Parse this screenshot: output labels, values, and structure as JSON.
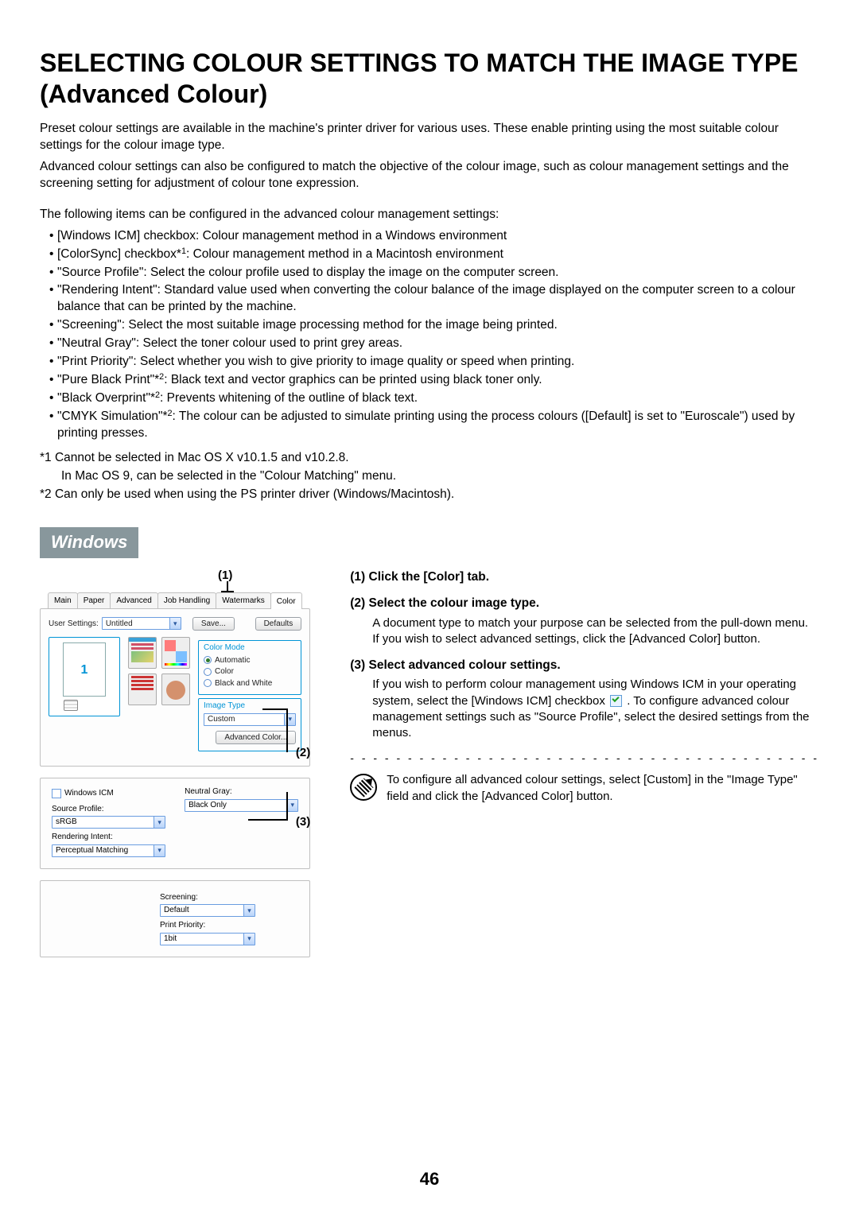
{
  "title": "SELECTING COLOUR SETTINGS TO MATCH THE IMAGE TYPE (Advanced Colour)",
  "intro1": "Preset colour settings are available in the machine's printer driver for various uses. These enable printing using the most suitable colour settings for the colour image type.",
  "intro1b": "Advanced colour settings can also be configured to match the objective of the colour image, such as colour management settings and the screening setting for adjustment of colour tone expression.",
  "intro2": "The following items can be configured in the advanced colour management settings:",
  "bullets": {
    "b0": "[Windows ICM] checkbox: Colour management method in a Windows environment",
    "b1a": "[ColorSync] checkbox*",
    "b1b": ":  Colour management method in a Macintosh environment",
    "b2": "\"Source Profile\":  Select the colour profile used to display the image on the computer screen.",
    "b3": "\"Rendering Intent\": Standard value used when converting the colour balance of the image displayed on the computer screen to a colour balance that can be printed by the machine.",
    "b4": "\"Screening\":  Select the most suitable image processing method for the image being printed.",
    "b5": "\"Neutral Gray\":  Select the toner colour used to print grey areas.",
    "b6": "\"Print Priority\":   Select whether you wish to give priority to image quality or speed when printing.",
    "b7a": "\"Pure Black Print\"*",
    "b7b": ":  Black text and vector graphics can be printed using black toner only.",
    "b8a": "\"Black Overprint\"*",
    "b8b": ":  Prevents whitening of the outline of black text.",
    "b9a": "\"CMYK Simulation\"*",
    "b9b": ":  The colour can be adjusted to simulate printing using the process colours ([Default] is set to \"Euroscale\") used by printing presses."
  },
  "sup": {
    "s1": "1",
    "s2": "2"
  },
  "footnotes": {
    "f1": "*1  Cannot be selected in Mac OS X v10.1.5 and v10.2.8.",
    "f1b": "In Mac OS 9, can be selected in the \"Colour Matching\" menu.",
    "f2": "*2  Can only be used when using the PS printer driver (Windows/Macintosh)."
  },
  "osbar": "Windows",
  "callouts": {
    "c1": "(1)",
    "c2": "(2)",
    "c3": "(3)"
  },
  "shot": {
    "tabs": {
      "t0": "Main",
      "t1": "Paper",
      "t2": "Advanced",
      "t3": "Job Handling",
      "t4": "Watermarks",
      "t5": "Color"
    },
    "usersettings_label": "User Settings:",
    "usersettings_value": "Untitled",
    "save_btn": "Save...",
    "defaults_btn": "Defaults",
    "colormode_title": "Color Mode",
    "cm_auto": "Automatic",
    "cm_color": "Color",
    "cm_bw": "Black and White",
    "imagetype_title": "Image Type",
    "imagetype_value": "Custom",
    "advbtn": "Advanced Color...",
    "preview_num": "1",
    "f2": {
      "icm": "Windows ICM",
      "src_label": "Source Profile:",
      "src_value": "sRGB",
      "ri_label": "Rendering Intent:",
      "ri_value": "Perceptual Matching",
      "ng_label": "Neutral Gray:",
      "ng_value": "Black Only",
      "scr_label": "Screening:",
      "scr_value": "Default",
      "pp_label": "Print Priority:",
      "pp_value": "1bit"
    }
  },
  "steps": {
    "s1_hdr": "(1)  Click the [Color] tab.",
    "s2_hdr": "(2)  Select the colour image type.",
    "s2_body_a": "A document type to match your purpose can be selected from the pull-down menu.",
    "s2_body_b": "If you wish to select advanced settings, click the [Advanced Color] button.",
    "s3_hdr": "(3)  Select advanced colour settings.",
    "s3_body": "If you wish to perform colour management using Windows ICM in your operating system, select the [Windows ICM] checkbox ",
    "s3_body2": " . To configure advanced colour management settings such as \"Source Profile\", select the desired settings from the menus.",
    "tip": "To configure all advanced colour settings, select [Custom] in the \"Image Type\" field and click the [Advanced Color] button."
  },
  "dashes": "- - - - - - - - - - - - - - - - - - - - - - - - - - - - - - - - - - - - - - - - -",
  "pagenum": "46"
}
